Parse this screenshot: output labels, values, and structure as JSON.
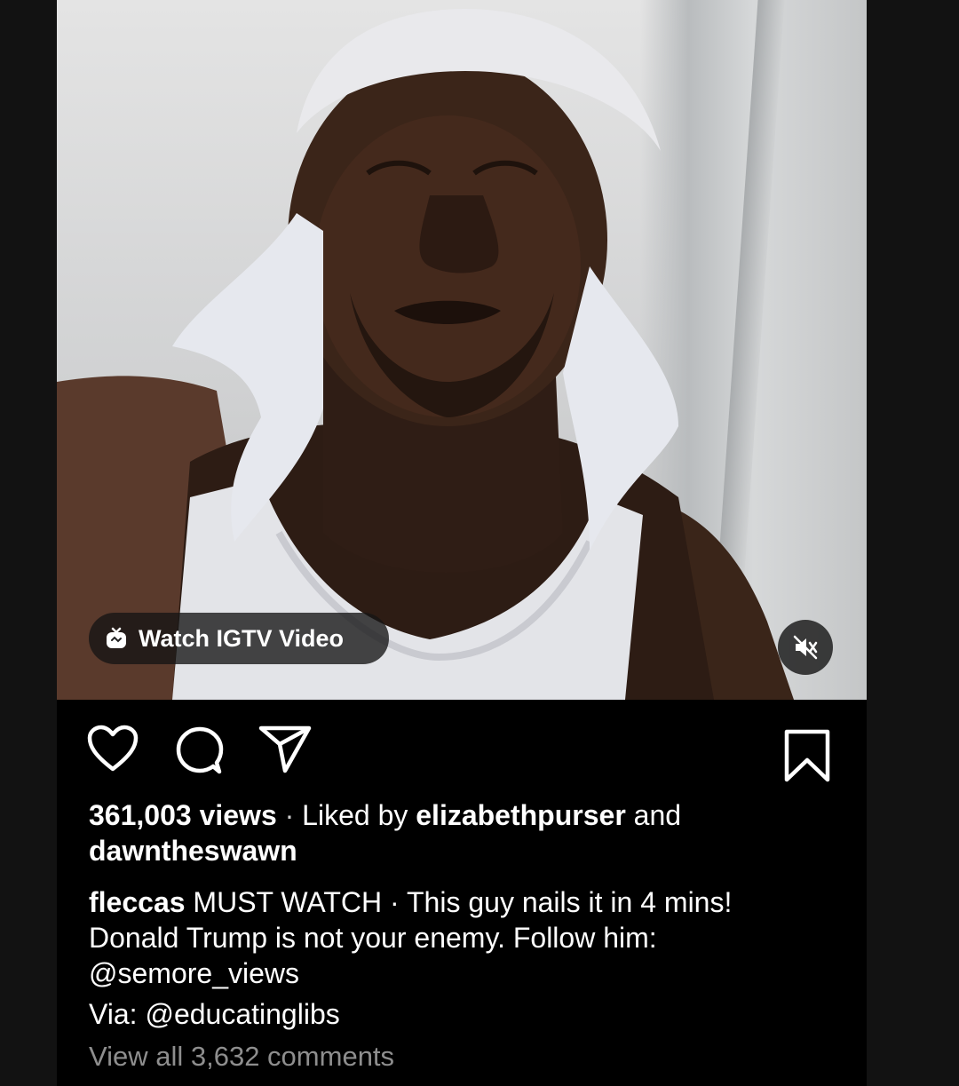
{
  "video": {
    "igtv_label": "Watch IGTV Video",
    "mute_icon": "speaker-muted-icon"
  },
  "actions": {
    "like_icon": "heart-icon",
    "comment_icon": "comment-bubble-icon",
    "share_icon": "paper-plane-icon",
    "save_icon": "bookmark-icon"
  },
  "stats": {
    "views": "361,003 views",
    "separator": "·",
    "liked_by_prefix": "Liked by",
    "liked_user_1": "elizabethpurser",
    "and": "and",
    "liked_user_2": "dawntheswawn"
  },
  "caption": {
    "username": "fleccas",
    "line1_rest": "MUST WATCH · This guy nails it in 4 mins!",
    "line2": "Donald Trump is not your enemy. Follow him:",
    "line3": "@semore_views",
    "line4": "Via: @educatinglibs"
  },
  "comments": {
    "label": "View all 3,632 comments"
  },
  "colors": {
    "background": "#121212",
    "post_background": "#000000",
    "text_primary": "#ffffff",
    "text_secondary": "#8e8e8e"
  }
}
